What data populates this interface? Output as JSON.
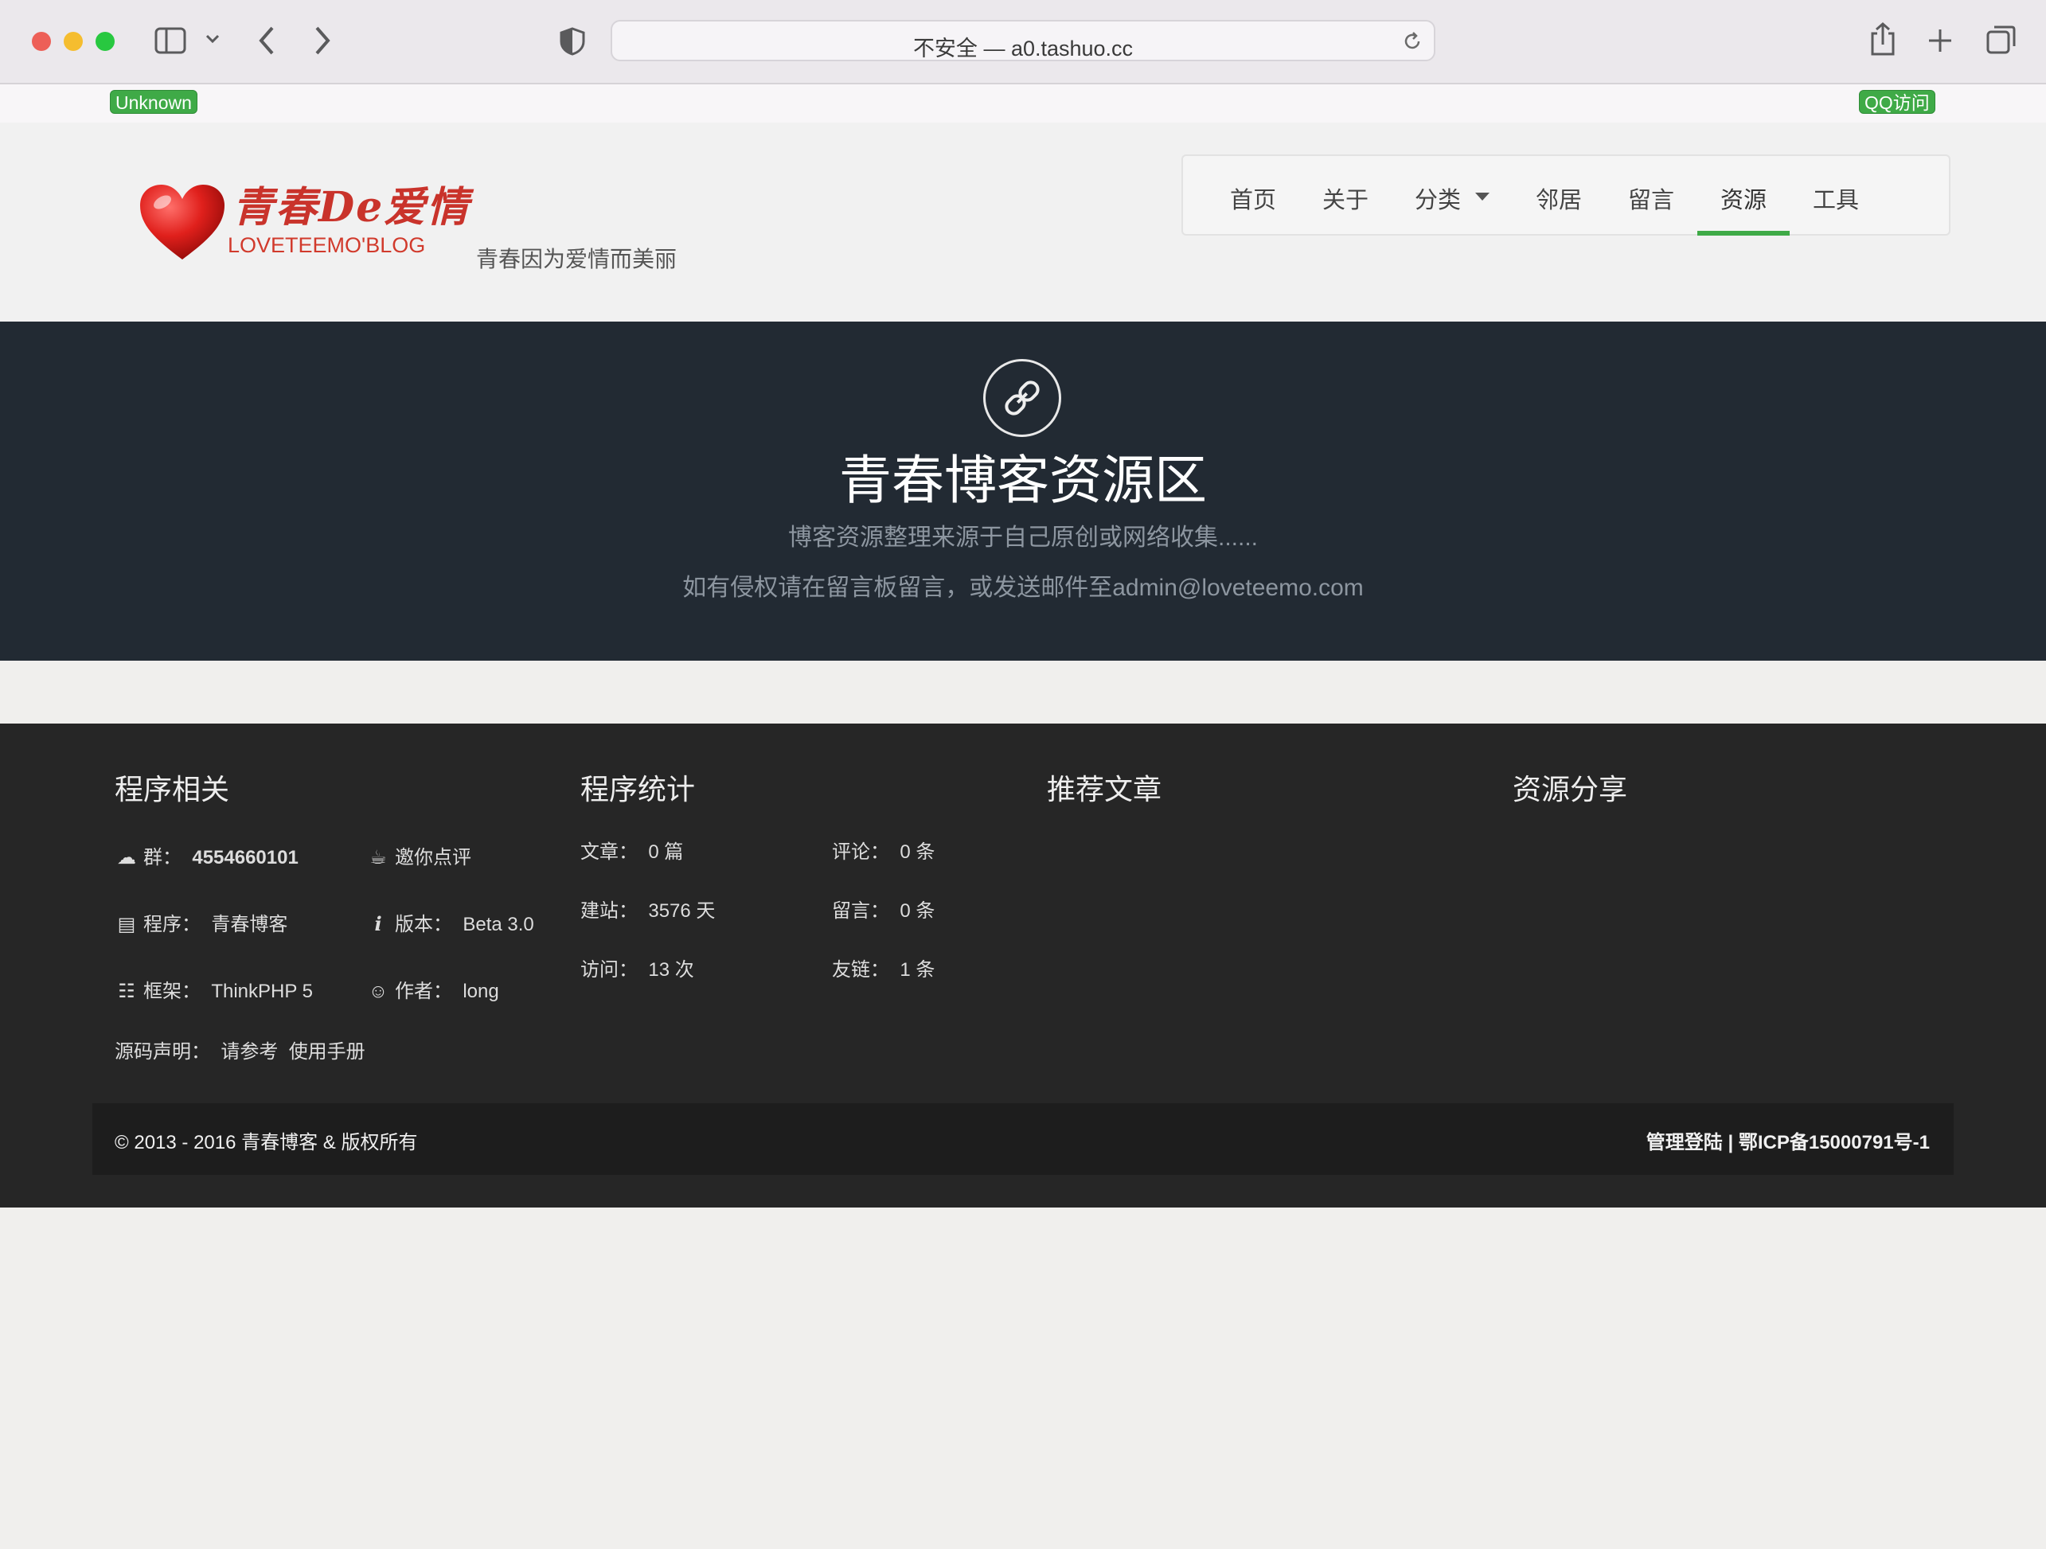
{
  "browser": {
    "url": "不安全 — a0.tashuo.cc"
  },
  "topbar": {
    "left_badge": "Unknown",
    "right_badge": "QQ访问"
  },
  "header": {
    "logo_cn": "青春De爱情",
    "logo_en": "LOVETEEMO'BLOG",
    "tagline": "青春因为爱情而美丽",
    "nav": [
      "首页",
      "关于",
      "分类",
      "邻居",
      "留言",
      "资源",
      "工具"
    ],
    "active_nav": "资源"
  },
  "hero": {
    "title": "青春博客资源区",
    "line1": "博客资源整理来源于自己原创或网络收集......",
    "line2": "如有侵权请在留言板留言，或发送邮件至admin@loveteemo.com"
  },
  "footer": {
    "col1": {
      "title": "程序相关",
      "group_label": "群：",
      "group_value": "4554660101",
      "invite": "邀你点评",
      "program_label": "程序：",
      "program_value": "青春博客",
      "version_label": "版本：",
      "version_value": "Beta 3.0",
      "framework_label": "框架：",
      "framework_value": "ThinkPHP 5",
      "author_label": "作者：",
      "author_value": "long",
      "source_label": "源码声明：",
      "source_ref": "请参考",
      "manual": "使用手册"
    },
    "col2": {
      "title": "程序统计",
      "articles_label": "文章：",
      "articles_value": "0 篇",
      "comments_label": "评论：",
      "comments_value": "0 条",
      "days_label": "建站：",
      "days_value": "3576 天",
      "messages_label": "留言：",
      "messages_value": "0 条",
      "visits_label": "访问：",
      "visits_value": "13 次",
      "links_label": "友链：",
      "links_value": "1 条"
    },
    "col3": {
      "title": "推荐文章"
    },
    "col4": {
      "title": "资源分享"
    },
    "copyright": "© 2013 - 2016 青春博客 & 版权所有",
    "admin_login": "管理登陆",
    "separator": "|",
    "icp": "鄂ICP备15000791号-1"
  },
  "colors": {
    "accent": "#3faa47",
    "hero_bg": "#222a33",
    "footer_bg": "#262626"
  }
}
